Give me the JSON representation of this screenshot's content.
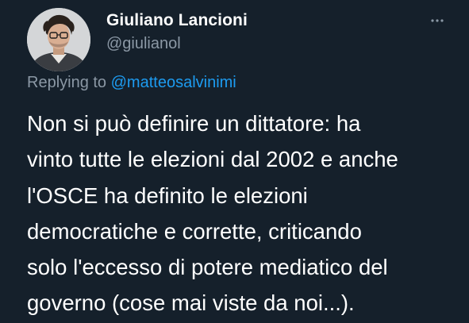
{
  "author": {
    "display_name": "Giuliano Lancioni",
    "handle": "@giulianol",
    "avatar_icon": "profile-photo"
  },
  "menu": {
    "icon": "more-horizontal-icon"
  },
  "reply": {
    "prefix": "Replying to",
    "to_handle": "@matteosalvinimi"
  },
  "tweet": {
    "lines": [
      "Non si può definire un dittatore: ha",
      "vinto tutte le elezioni dal 2002 e anche",
      "l'OSCE ha definito le elezioni",
      "democratiche e corrette, criticando",
      "solo l'eccesso di potere mediatico del",
      "governo (cose mai viste da noi...)."
    ]
  },
  "colors": {
    "background": "#15202b",
    "primary_text": "#ffffff",
    "secondary_text": "#8b98a5",
    "link": "#1d9bf0"
  }
}
